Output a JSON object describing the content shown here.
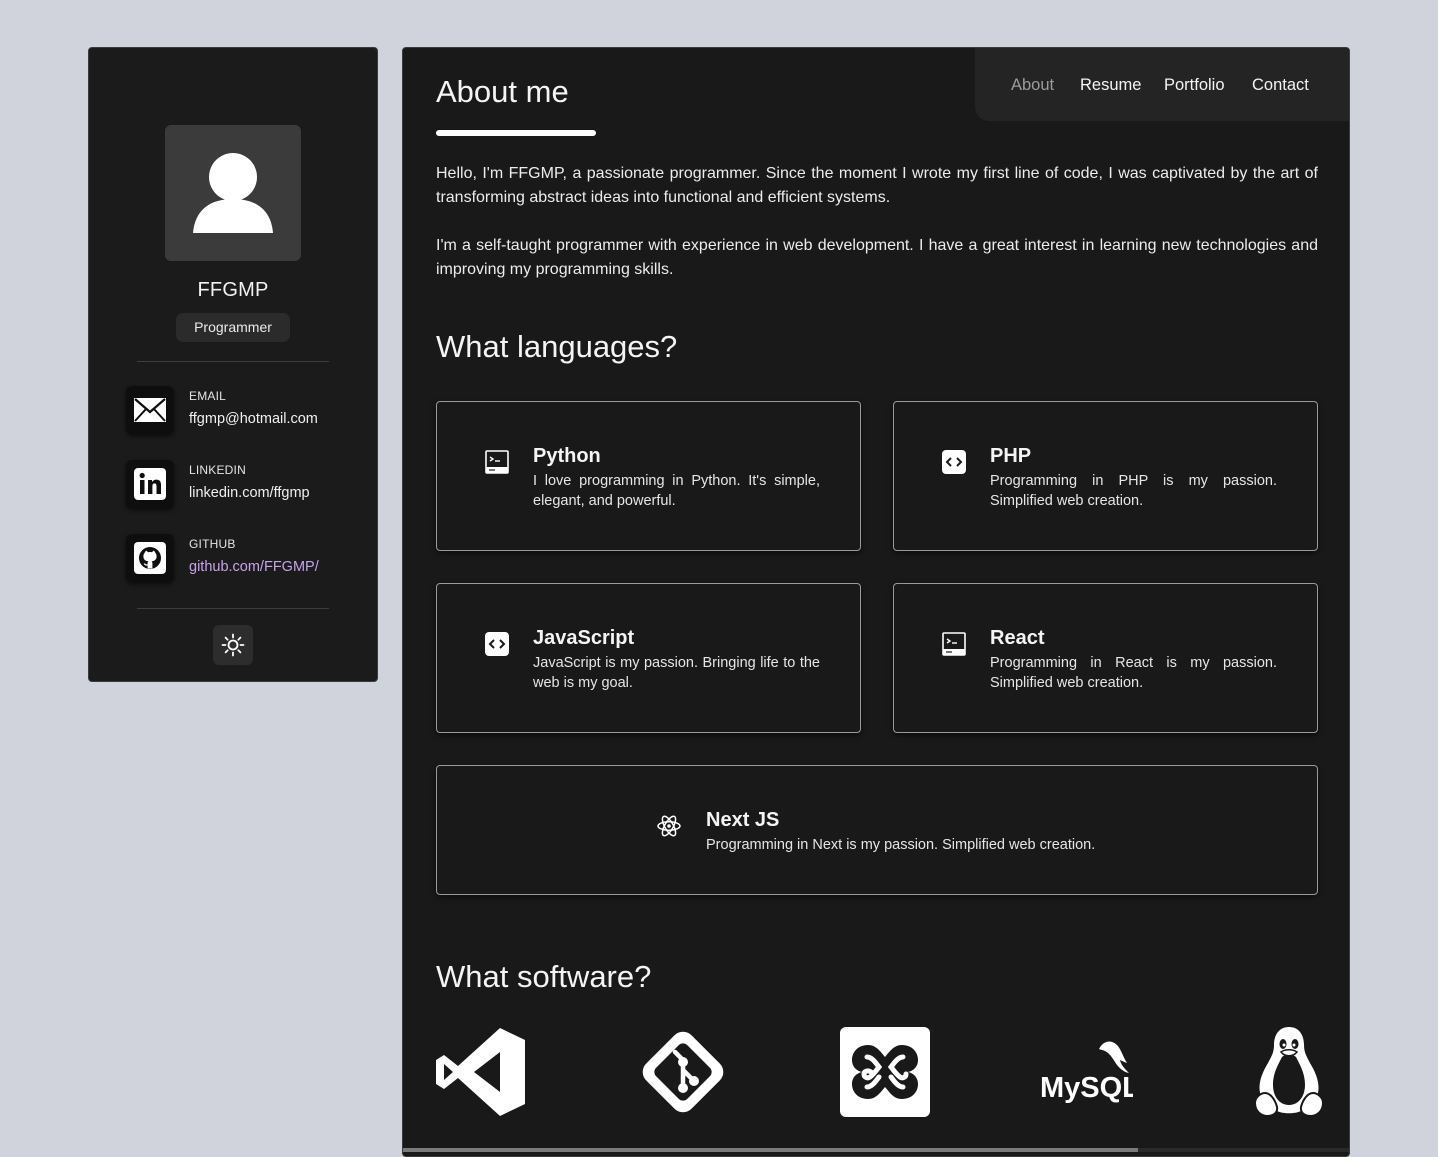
{
  "profile": {
    "name": "FFGMP",
    "role": "Programmer"
  },
  "contacts": [
    {
      "label": "EMAIL",
      "value": "ffgmp@hotmail.com",
      "icon": "mail-icon"
    },
    {
      "label": "LINKEDIN",
      "value": "linkedin.com/ffgmp",
      "icon": "linkedin-icon"
    },
    {
      "label": "GITHUB",
      "value": "github.com/FFGMP/",
      "icon": "github-icon"
    }
  ],
  "nav": {
    "items": [
      "About",
      "Resume",
      "Portfolio",
      "Contact"
    ],
    "active": "About"
  },
  "about": {
    "title": "About me",
    "paragraphs": [
      "Hello, I'm FFGMP, a passionate programmer. Since the moment I wrote my first line of code, I was captivated by the art of transforming abstract ideas into functional and efficient systems.",
      "I'm a self-taught programmer with experience in web development. I have a great interest in learning new technologies and improving my programming skills."
    ]
  },
  "languages": {
    "title": "What languages?",
    "cards": [
      {
        "name": "Python",
        "desc": "I love programming in Python. It's simple, elegant, and powerful.",
        "icon": "terminal-icon"
      },
      {
        "name": "PHP",
        "desc": "Programming in PHP is my passion. Simplified web creation.",
        "icon": "code-icon"
      },
      {
        "name": "JavaScript",
        "desc": "JavaScript is my passion. Bringing life to the web is my goal.",
        "icon": "code-icon"
      },
      {
        "name": "React",
        "desc": "Programming in React is my passion. Simplified web creation.",
        "icon": "terminal-icon"
      },
      {
        "name": "Next JS",
        "desc": "Programming in Next is my passion. Simplified web creation.",
        "icon": "atom-icon"
      }
    ]
  },
  "software": {
    "title": "What software?",
    "items": [
      {
        "name": "vscode-icon"
      },
      {
        "name": "git-icon"
      },
      {
        "name": "xampp-icon"
      },
      {
        "name": "mysql-icon",
        "text": "MySQL"
      },
      {
        "name": "linux-icon"
      }
    ]
  },
  "colors": {
    "background": "#d1d3dc",
    "panel": "#191919",
    "link": "#c8a2ec"
  }
}
